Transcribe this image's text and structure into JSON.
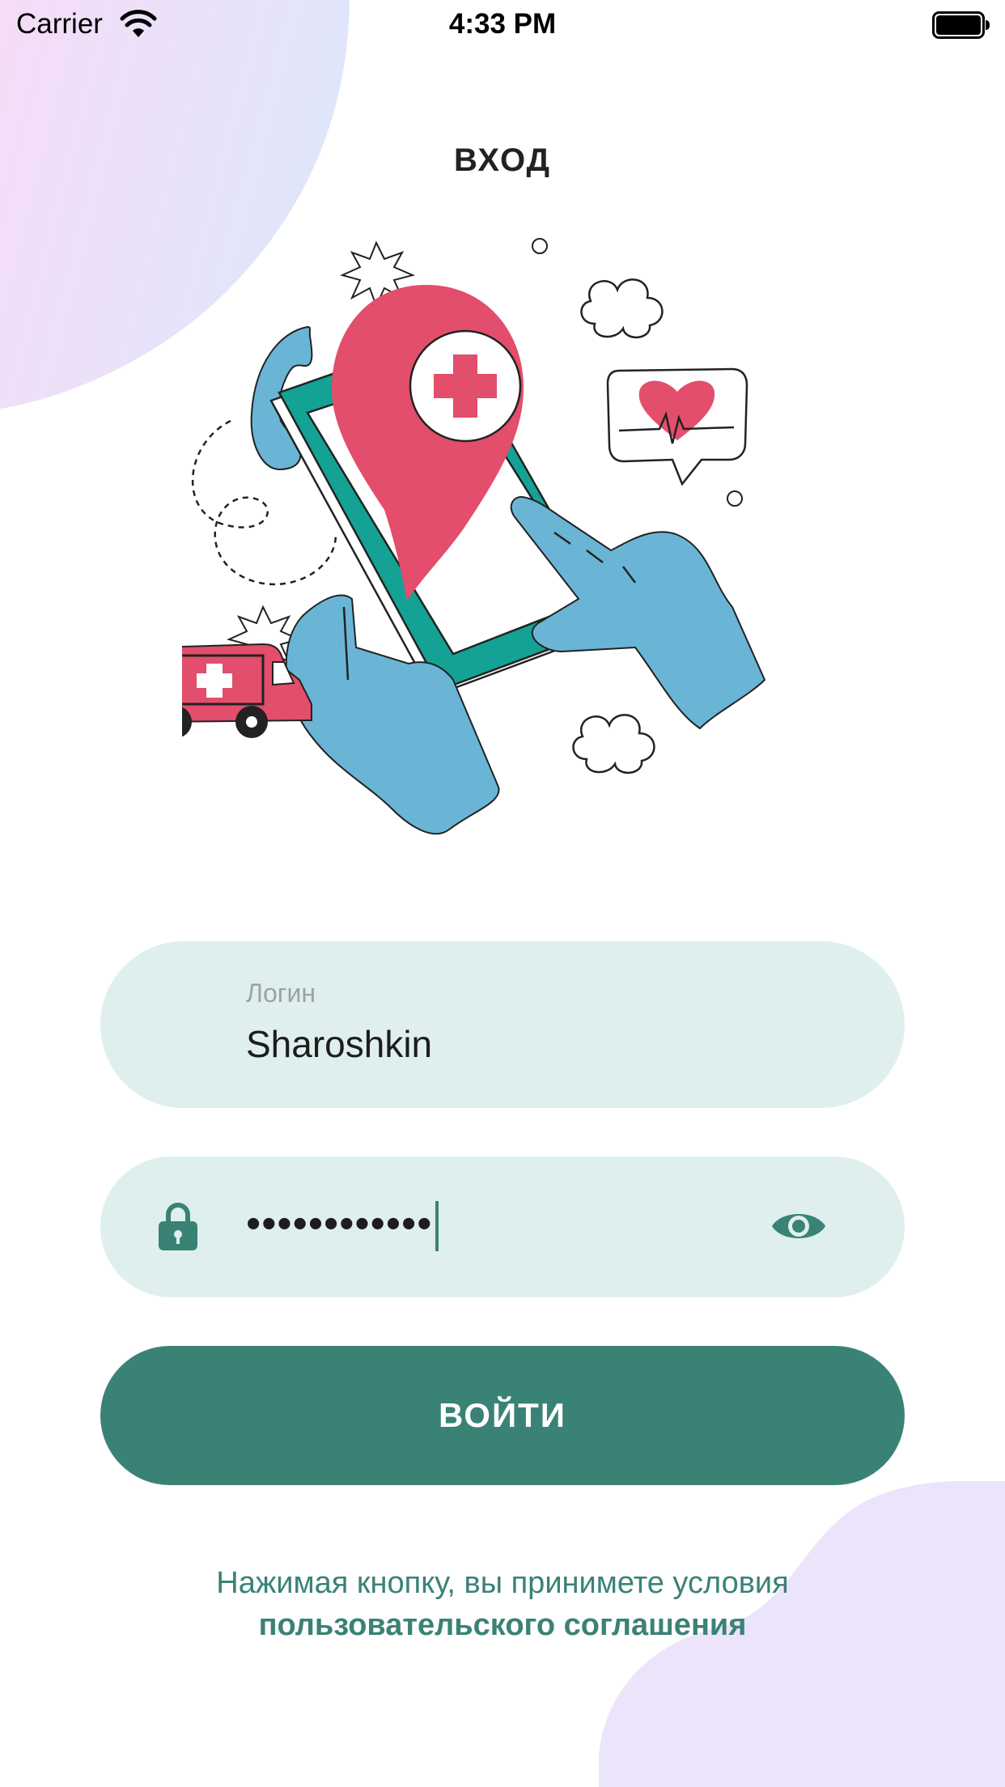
{
  "status_bar": {
    "carrier": "Carrier",
    "time": "4:33 PM"
  },
  "screen": {
    "title": "ВХОД"
  },
  "login_field": {
    "label": "Логин",
    "value": "Sharoshkin"
  },
  "password_field": {
    "masked_value": "••••••••••••"
  },
  "login_button": {
    "label": "ВОЙТИ"
  },
  "agreement": {
    "text": "Нажимая кнопку, вы принимете условия",
    "link": "пользовательского соглашения"
  },
  "colors": {
    "accent": "#3a8276",
    "field_bg": "#dfefed",
    "illustration_red": "#e24e6b",
    "illustration_blue": "#6ab5d6",
    "illustration_teal": "#13a294"
  },
  "icons": {
    "lock": "lock-icon",
    "eye": "eye-icon",
    "wifi": "wifi-icon",
    "battery": "battery-icon"
  }
}
